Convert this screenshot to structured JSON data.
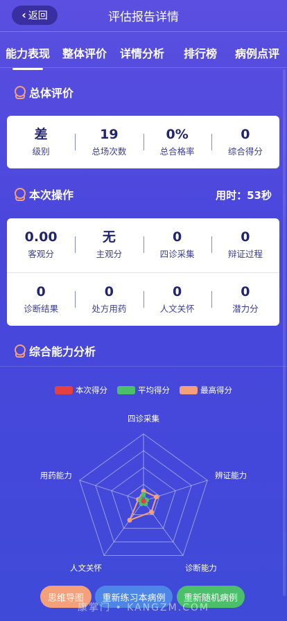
{
  "header": {
    "back_label": "返回",
    "title": "评估报告详情"
  },
  "tabs": [
    {
      "label": "能力表现",
      "active": true
    },
    {
      "label": "整体评价",
      "active": false
    },
    {
      "label": "详情分析",
      "active": false
    },
    {
      "label": "排行榜",
      "active": false
    },
    {
      "label": "病例点评",
      "active": false
    }
  ],
  "overall": {
    "title": "总体评价",
    "stats": [
      {
        "value": "差",
        "label": "级别"
      },
      {
        "value": "19",
        "label": "总场次数"
      },
      {
        "value": "0%",
        "label": "总合格率"
      },
      {
        "value": "0",
        "label": "综合得分"
      }
    ]
  },
  "operation": {
    "title": "本次操作",
    "time_text": "用时：53秒",
    "row1": [
      {
        "value": "0.00",
        "label": "客观分"
      },
      {
        "value": "无",
        "label": "主观分"
      },
      {
        "value": "0",
        "label": "四诊采集"
      },
      {
        "value": "0",
        "label": "辩证过程"
      }
    ],
    "row2": [
      {
        "value": "0",
        "label": "诊断结果"
      },
      {
        "value": "0",
        "label": "处方用药"
      },
      {
        "value": "0",
        "label": "人文关怀"
      },
      {
        "value": "0",
        "label": "潜力分"
      }
    ]
  },
  "analysis": {
    "title": "综合能力分析"
  },
  "chart_data": {
    "type": "radar",
    "axes": [
      "四诊采集",
      "辨证能力",
      "诊断能力",
      "人文关怀",
      "用药能力"
    ],
    "max": 100,
    "series": [
      {
        "name": "本次得分",
        "color": "#e2413f",
        "values": [
          0,
          0,
          0,
          0,
          0
        ]
      },
      {
        "name": "平均得分",
        "color": "#4cbf6a",
        "values": [
          10,
          5,
          5,
          5,
          5
        ]
      },
      {
        "name": "最高得分",
        "color": "#f4a07a",
        "values": [
          15,
          20,
          20,
          35,
          8
        ]
      }
    ]
  },
  "buttons": [
    {
      "label": "思维导图",
      "color": "#f4a07a"
    },
    {
      "label": "重新练习本病例",
      "color": "#4d86e6"
    },
    {
      "label": "重新随机病例",
      "color": "#4cbf6a"
    }
  ],
  "watermark": "康掌门 • KANGZM.COM",
  "icons": {
    "back": "chevron-left-icon",
    "section": "location-pin-icon"
  }
}
